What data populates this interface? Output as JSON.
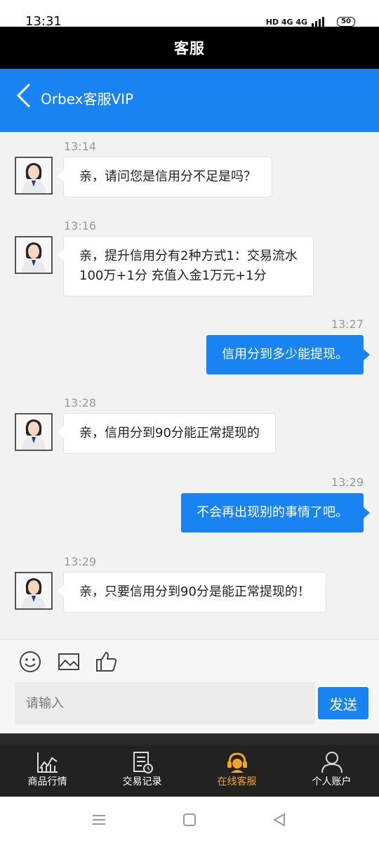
{
  "status_bar": {
    "time": "13:31",
    "network": "HD 4G 4G",
    "battery": "50"
  },
  "title_bar": {
    "title": "客服"
  },
  "chat_header": {
    "agent_name": "Orbex客服VIP"
  },
  "messages": [
    {
      "time": "13:14",
      "from": "agent",
      "text": "亲，请问您是信用分不足是吗？"
    },
    {
      "time": "13:16",
      "from": "agent",
      "line1": "亲，提升信用分有2种方式1：交易流水",
      "line2": "100万+1分 充值入金1万元+1分"
    },
    {
      "time": "13:27",
      "from": "user",
      "text": "信用分到多少能提现。"
    },
    {
      "time": "13:28",
      "from": "agent",
      "text": "亲，信用分到90分能正常提现的"
    },
    {
      "time": "13:29",
      "from": "user",
      "text": "不会再出现别的事情了吧。"
    },
    {
      "time": "13:29",
      "from": "agent",
      "text": "亲，只要信用分到90分是能正常提现的！"
    }
  ],
  "composer": {
    "placeholder": "请输入",
    "send_label": "发送",
    "tools": [
      "emoji-icon",
      "image-icon",
      "thumbs-up-icon"
    ]
  },
  "bottom_nav": {
    "items": [
      {
        "label": "商品行情",
        "icon": "chart-icon",
        "active": false
      },
      {
        "label": "交易记录",
        "icon": "record-icon",
        "active": false
      },
      {
        "label": "在线客服",
        "icon": "headset-icon",
        "active": true
      },
      {
        "label": "个人账户",
        "icon": "user-icon",
        "active": false
      }
    ]
  },
  "colors": {
    "accent": "#1a83f2",
    "nav_active": "#f2a423",
    "title_bar": "#000000"
  }
}
